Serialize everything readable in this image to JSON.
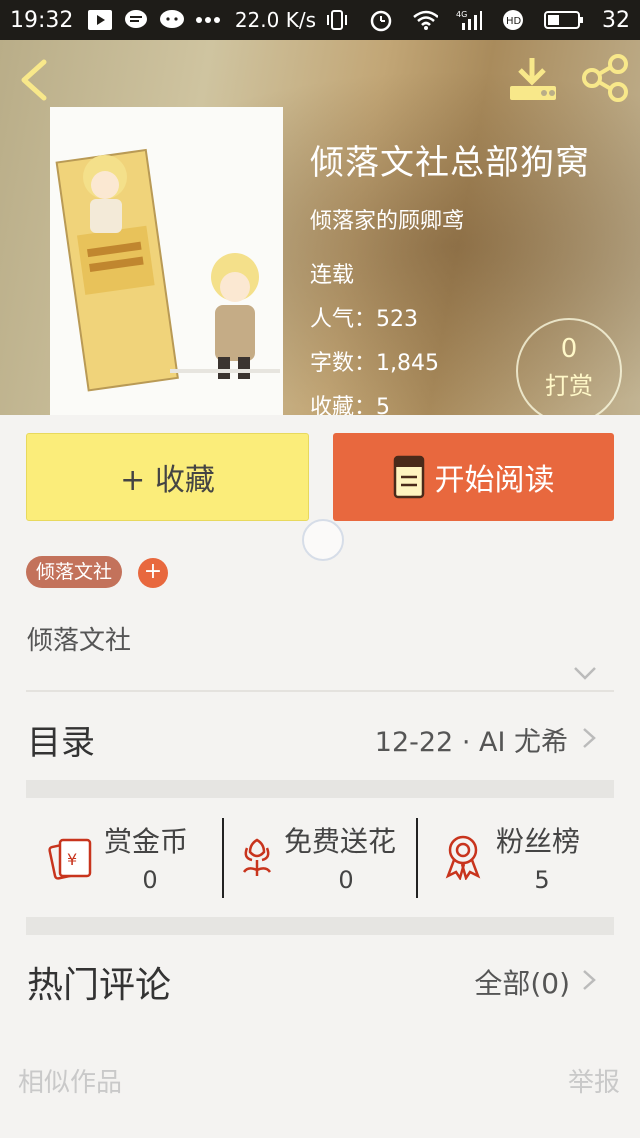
{
  "status_bar": {
    "time": "19:32",
    "speed": "22.0 K/s",
    "battery": "32",
    "network": "4G"
  },
  "book": {
    "title": "倾落文社总部狗窝",
    "author": "倾落家的顾卿鸢",
    "status": "连载",
    "popularity_label": "人气：",
    "popularity": "523",
    "words_label": "字数：",
    "words": "1,845",
    "favorites_label": "收藏：",
    "favorites": "5",
    "cover_icon": "book-cover-illustration"
  },
  "tip": {
    "count": "0",
    "label": "打赏"
  },
  "actions": {
    "collect_label": "+ 收藏",
    "read_label": "开始阅读"
  },
  "tags": {
    "items": [
      "倾落文社"
    ],
    "add_label": "+"
  },
  "description": "倾落文社",
  "catalog": {
    "label": "目录",
    "latest": "12-22 · AI 尤希"
  },
  "stats": {
    "items": [
      {
        "label": "赏金币",
        "value": "0",
        "icon": "red-envelope-icon"
      },
      {
        "label": "免费送花",
        "value": "0",
        "icon": "flower-icon"
      },
      {
        "label": "粉丝榜",
        "value": "5",
        "icon": "medal-icon"
      }
    ]
  },
  "comments": {
    "label": "热门评论",
    "all_label": "全部(0)"
  },
  "footer": {
    "similar": "相似作品",
    "report": "举报"
  },
  "colors": {
    "accent_orange": "#e8683e",
    "collect_yellow": "#fbed7a",
    "tag_brown": "#c3725b",
    "icon_red": "#c8341d"
  }
}
